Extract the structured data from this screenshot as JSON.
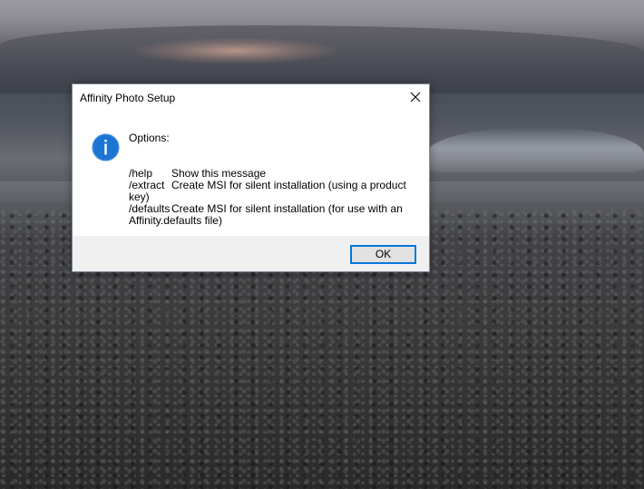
{
  "dialog": {
    "title": "Affinity Photo Setup",
    "heading": "Options:",
    "options": [
      {
        "key": "/help",
        "desc": "Show this message",
        "desc_cont": ""
      },
      {
        "key": "/extract",
        "desc": "Create MSI for silent installation (using a product",
        "desc_cont": "key)"
      },
      {
        "key": "/defaults",
        "desc": "Create MSI for silent installation (for use with an",
        "desc_cont": "Affinity.defaults file)"
      }
    ],
    "ok_label": "OK",
    "icon": "info-icon",
    "close_icon": "close-icon"
  },
  "colors": {
    "info_icon": "#1c75d3",
    "button_focus": "#0078d7",
    "footer_bg": "#f0f0f0"
  }
}
